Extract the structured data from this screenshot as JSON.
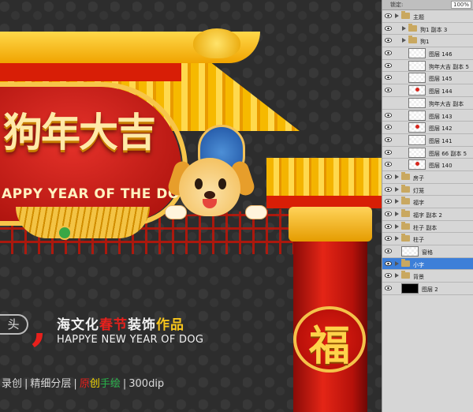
{
  "artwork": {
    "title_cn": "狗年大吉",
    "title_en": "APPY YEAR OF THE DOG",
    "fu_char": "福",
    "badge_char": "头",
    "slogan_cn": [
      {
        "text": "海文化",
        "color": "w"
      },
      {
        "text": "春节",
        "color": "r"
      },
      {
        "text": "装饰",
        "color": "w"
      },
      {
        "text": "作品",
        "color": "y"
      }
    ],
    "slogan_en": "HAPPYE NEW YEAR OF DOG",
    "footer": [
      {
        "text": "录创",
        "color": ""
      },
      {
        "text": "|",
        "color": "sep"
      },
      {
        "text": "精细分层",
        "color": ""
      },
      {
        "text": "|",
        "color": "sep"
      },
      {
        "text": "原",
        "color": "c1"
      },
      {
        "text": "创",
        "color": "c2"
      },
      {
        "text": "手绘",
        "color": "c3"
      },
      {
        "text": "|",
        "color": "sep"
      },
      {
        "text": "300dip",
        "color": ""
      }
    ]
  },
  "layers_panel": {
    "lock_label": "锁定:",
    "opacity": "100%",
    "layers": [
      {
        "name": "主题",
        "type": "group",
        "indent": 0,
        "visible": true,
        "selected": false
      },
      {
        "name": "狗1 副本 3",
        "type": "group",
        "indent": 1,
        "visible": true,
        "selected": false
      },
      {
        "name": "狗1",
        "type": "group",
        "indent": 1,
        "visible": true,
        "selected": false
      },
      {
        "name": "图层 146",
        "type": "layer",
        "indent": 1,
        "visible": true,
        "selected": false,
        "thumb": "empty"
      },
      {
        "name": "狗年大吉 副本 5",
        "type": "layer",
        "indent": 1,
        "visible": true,
        "selected": false,
        "thumb": "empty"
      },
      {
        "name": "图层 145",
        "type": "layer",
        "indent": 1,
        "visible": true,
        "selected": false,
        "thumb": "empty"
      },
      {
        "name": "图层 144",
        "type": "layer",
        "indent": 1,
        "visible": true,
        "selected": false,
        "thumb": "dot"
      },
      {
        "name": "狗年大吉 副本",
        "type": "layer",
        "indent": 1,
        "visible": false,
        "selected": false,
        "thumb": "empty"
      },
      {
        "name": "图层 143",
        "type": "layer",
        "indent": 1,
        "visible": true,
        "selected": false,
        "thumb": "empty"
      },
      {
        "name": "图层 142",
        "type": "layer",
        "indent": 1,
        "visible": true,
        "selected": false,
        "thumb": "dot"
      },
      {
        "name": "图层 141",
        "type": "layer",
        "indent": 1,
        "visible": true,
        "selected": false,
        "thumb": "empty"
      },
      {
        "name": "图层 66 副本 5",
        "type": "layer",
        "indent": 1,
        "visible": true,
        "selected": false,
        "thumb": "empty"
      },
      {
        "name": "图层 140",
        "type": "layer",
        "indent": 1,
        "visible": true,
        "selected": false,
        "thumb": "dot"
      },
      {
        "name": "房子",
        "type": "group",
        "indent": 0,
        "visible": true,
        "selected": false
      },
      {
        "name": "灯笼",
        "type": "group",
        "indent": 0,
        "visible": true,
        "selected": false
      },
      {
        "name": "福字",
        "type": "group",
        "indent": 0,
        "visible": true,
        "selected": false
      },
      {
        "name": "福字 副本 2",
        "type": "group",
        "indent": 0,
        "visible": true,
        "selected": false
      },
      {
        "name": "柱子 副本",
        "type": "group",
        "indent": 0,
        "visible": true,
        "selected": false
      },
      {
        "name": "柱子",
        "type": "group",
        "indent": 0,
        "visible": true,
        "selected": false
      },
      {
        "name": "窗格",
        "type": "layer",
        "indent": 0,
        "visible": true,
        "selected": false,
        "thumb": "empty"
      },
      {
        "name": "小字",
        "type": "group",
        "indent": 0,
        "visible": true,
        "selected": true
      },
      {
        "name": "背景",
        "type": "group",
        "indent": 0,
        "visible": true,
        "selected": false
      },
      {
        "name": "图层 2",
        "type": "layer",
        "indent": 0,
        "visible": true,
        "selected": false,
        "thumb": "black"
      }
    ]
  }
}
